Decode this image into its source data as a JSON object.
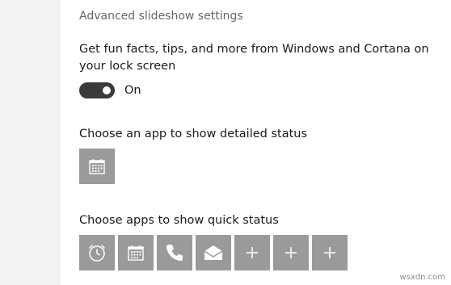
{
  "settings": {
    "advanced_link": "Advanced slideshow settings",
    "fun_facts_label": "Get fun facts, tips, and more from Windows and Cortana on your lock screen",
    "toggle_state": "On",
    "detailed_status_label": "Choose an app to show detailed status",
    "quick_status_label": "Choose apps to show quick status",
    "detailed_status_app": "calendar-icon",
    "quick_status_apps": [
      "alarm-clock-icon",
      "calendar-icon",
      "phone-icon",
      "mail-icon",
      "plus-icon",
      "plus-icon",
      "plus-icon"
    ]
  },
  "colors": {
    "tile_background": "#9a9a9a",
    "toggle_on": "#3a3a3a",
    "left_pane": "#f2f2f2"
  },
  "watermark": "wsxdn.com"
}
